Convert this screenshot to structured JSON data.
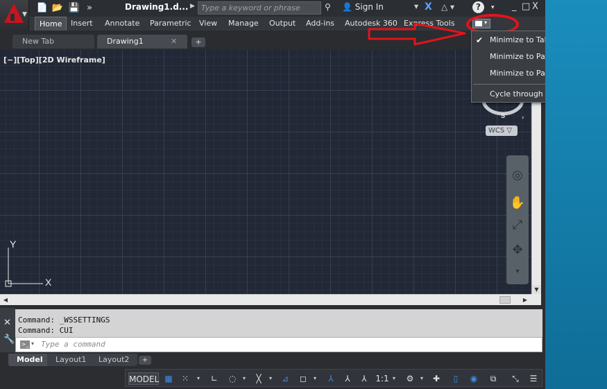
{
  "window": {
    "doc_title": "Drawing1.d...",
    "minimize": "_",
    "restore": "□",
    "close": "X"
  },
  "quick_access": {
    "new": "📄",
    "open": "📂",
    "save": "💾",
    "more": "»"
  },
  "search": {
    "placeholder": "Type a keyword or phrase"
  },
  "user": {
    "sign_in": "Sign In"
  },
  "ribbon": {
    "tabs": [
      "Home",
      "Insert",
      "Annotate",
      "Parametric",
      "View",
      "Manage",
      "Output",
      "Add-ins",
      "Autodesk 360",
      "Express Tools"
    ],
    "active_tab": "Home"
  },
  "file_tabs": [
    {
      "label": "New Tab"
    },
    {
      "label": "Drawing1"
    }
  ],
  "viewport": {
    "label": "[−][Top][2D Wireframe]",
    "compass_south": "S",
    "wcs": "WCS"
  },
  "ucs": {
    "x": "X",
    "y": "Y"
  },
  "command": {
    "history": [
      "Command: _WSSETTINGS",
      "Command: CUI"
    ],
    "placeholder": "Type a command"
  },
  "layout_tabs": [
    "Model",
    "Layout1",
    "Layout2"
  ],
  "status_bar": {
    "model": "MODEL",
    "scale": "1:1"
  },
  "menu": {
    "items": [
      {
        "label": "Minimize to Tabs",
        "checked": true
      },
      {
        "label": "Minimize to Panel Titles",
        "checked": false
      },
      {
        "label": "Minimize to Panel Buttons",
        "checked": false
      },
      {
        "label": "Cycle through All",
        "checked": false
      }
    ],
    "check_glyph": "✔"
  },
  "colors": {
    "annotation_red": "#e0141c",
    "accent_blue": "#3c8fe6",
    "desktop_blue": "#1a8dbd"
  }
}
